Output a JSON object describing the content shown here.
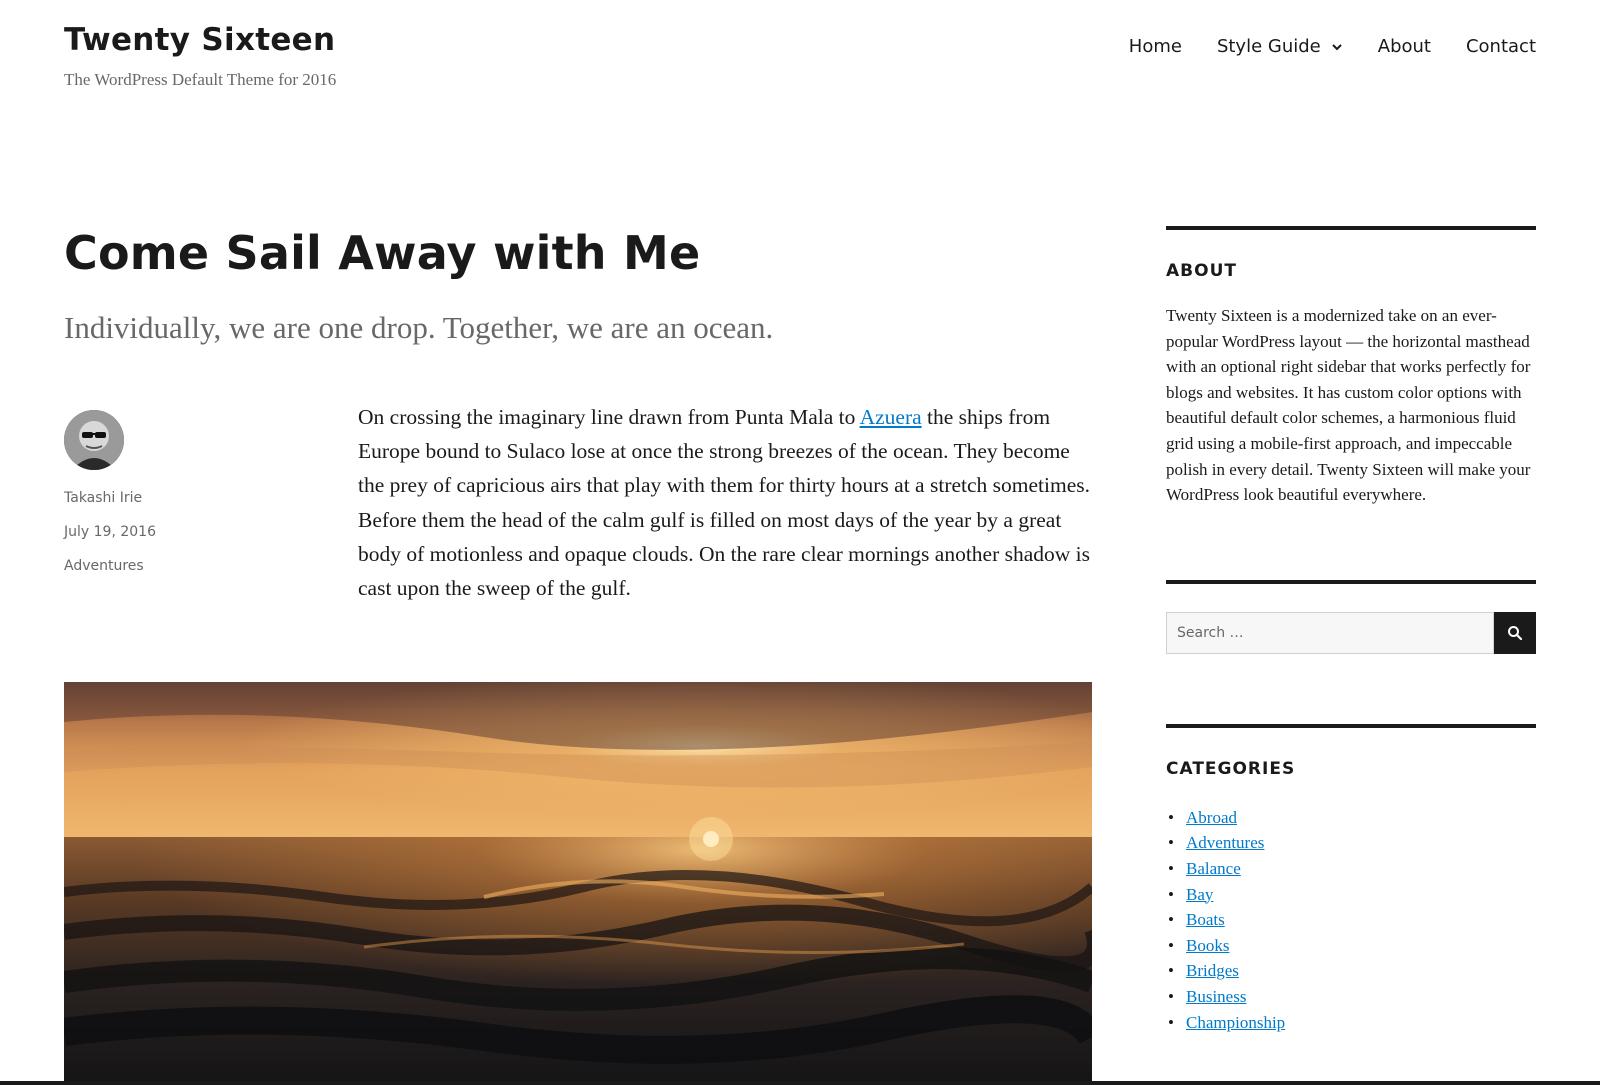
{
  "site": {
    "title": "Twenty Sixteen",
    "description": "The WordPress Default Theme for 2016"
  },
  "nav": {
    "items": [
      {
        "label": "Home"
      },
      {
        "label": "Style Guide",
        "has_dropdown": true
      },
      {
        "label": "About"
      },
      {
        "label": "Contact"
      }
    ]
  },
  "post": {
    "title": "Come Sail Away with Me",
    "subtitle": "Individually, we are one drop. Together, we are an ocean.",
    "author": "Takashi Irie",
    "date": "July 19, 2016",
    "category": "Adventures",
    "body_before_link": "On crossing the imaginary line drawn from Punta Mala to ",
    "body_link": "Azuera",
    "body_after_link": " the ships from Europe bound to Sulaco lose at once the strong breezes of the ocean. They become the prey of capricious airs that play with them for thirty hours at a stretch sometimes. Before them the head of the calm gulf is filled on most days of the year by a great body of motionless and opaque clouds. On the rare clear mornings another shadow is cast upon the sweep of the gulf."
  },
  "sidebar": {
    "about": {
      "title": "ABOUT",
      "text": "Twenty Sixteen is a modernized take on an ever-popular WordPress layout — the horizontal masthead with an optional right sidebar that works perfectly for blogs and websites. It has custom color options with beautiful default color schemes, a harmonious fluid grid using a mobile-first approach, and impeccable polish in every detail. Twenty Sixteen will make your WordPress look beautiful everywhere."
    },
    "search": {
      "placeholder": "Search …"
    },
    "categories": {
      "title": "CATEGORIES",
      "items": [
        "Abroad",
        "Adventures",
        "Balance",
        "Bay",
        "Boats",
        "Books",
        "Bridges",
        "Business",
        "Championship"
      ]
    }
  },
  "colors": {
    "text": "#1a1a1a",
    "muted": "#686868",
    "link": "#007acc"
  }
}
